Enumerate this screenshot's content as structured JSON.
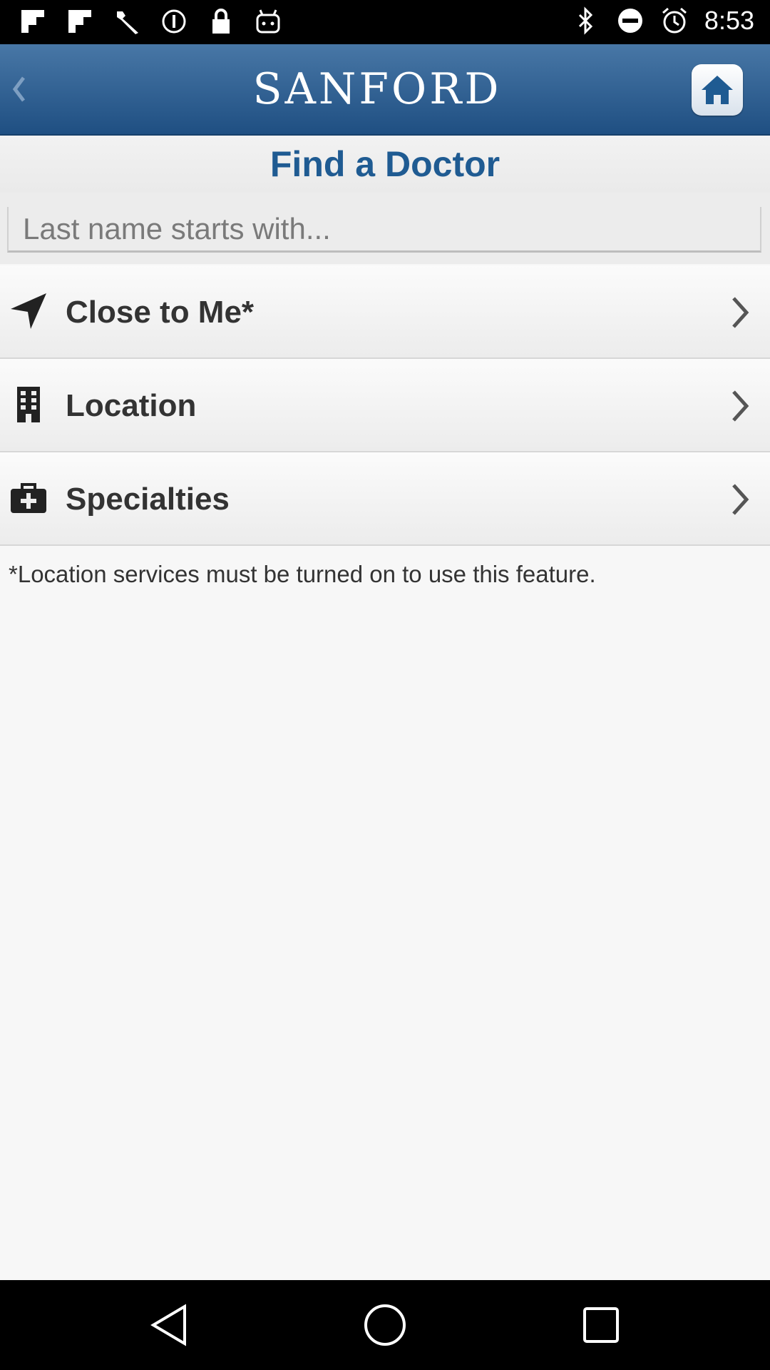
{
  "status_bar": {
    "time": "8:53",
    "left_icons": [
      "flipboard-icon",
      "flipboard-icon",
      "wrench-icon",
      "info-circle-icon",
      "lock-icon",
      "android-icon"
    ],
    "right_icons": [
      "bluetooth-icon",
      "do-not-disturb-icon",
      "alarm-icon",
      "signal-icon"
    ]
  },
  "header": {
    "brand": "SANFORD",
    "back_icon": "chevron-left-icon",
    "home_icon": "home-icon",
    "color_top": "#4877a6",
    "color_bottom": "#1f4f82"
  },
  "page": {
    "title": "Find a Doctor",
    "search_placeholder": "Last name starts with..."
  },
  "menu": [
    {
      "label": "Close to Me*",
      "icon": "navigation-arrow-icon"
    },
    {
      "label": "Location",
      "icon": "building-icon"
    },
    {
      "label": "Specialties",
      "icon": "medical-bag-icon"
    }
  ],
  "note": "*Location services must be turned on to use this feature.",
  "nav": {
    "back": "nav-back-icon",
    "home": "nav-home-icon",
    "recents": "nav-recents-icon"
  },
  "colors": {
    "title": "#1f5b92",
    "home_button_icon": "#1f5b92"
  }
}
